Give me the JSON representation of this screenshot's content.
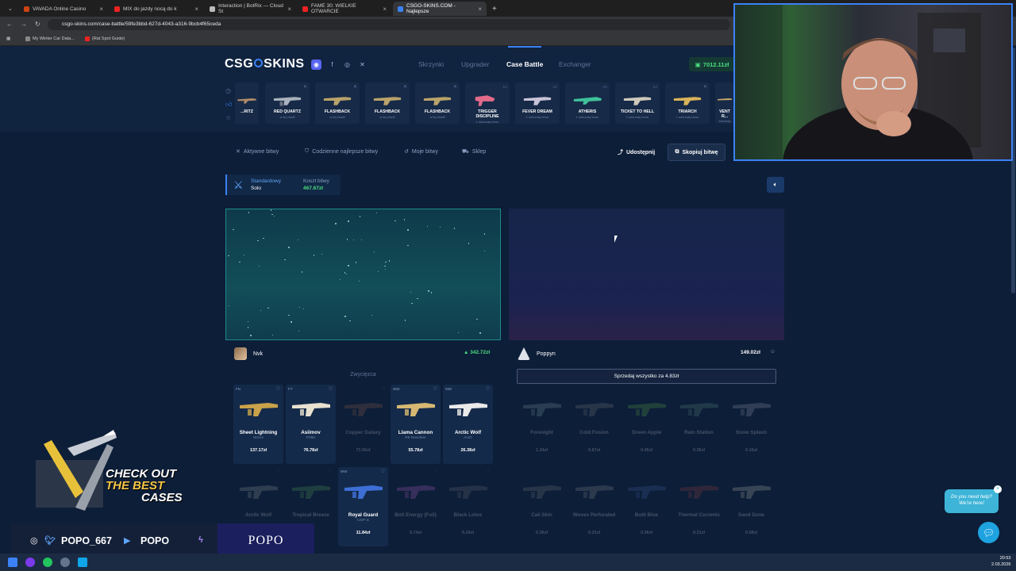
{
  "browser": {
    "tabs": [
      {
        "title": "VAVADA Online Casino"
      },
      {
        "title": "MIX do jazdy nocą do k"
      },
      {
        "title": "Interaction | BotRix — Cloud St"
      },
      {
        "title": "FAME 30: WIELKIE OTWARCIE"
      },
      {
        "title": "CSGO-SKINS.COM - Najlepsze"
      }
    ],
    "new_tab": "+",
    "url": "csgo-skins.com/case-battle/59fe3bbd-627d-4043-a316-9bcb4f65ceda",
    "bookmarks": [
      "My Winter Car Data...",
      "(Rat Spot Guide)"
    ]
  },
  "site": {
    "logo_left": "CSG",
    "logo_right": "SKINS",
    "nav": [
      "Skrzynki",
      "Upgrader",
      "Case Battle",
      "Exchanger"
    ],
    "balance": "7012.11zł",
    "drops": [
      {
        "name": "...RITZ",
        "sub": ""
      },
      {
        "name": "RED QUARTZ",
        "sub": "w tej chwili"
      },
      {
        "name": "FLASHBACK",
        "sub": "w tej chwili"
      },
      {
        "name": "FLASHBACK",
        "sub": "w tej chwili"
      },
      {
        "name": "FLASHBACK",
        "sub": "w tej chwili"
      },
      {
        "name": "TRIGGER DISCIPLINE",
        "sub": "1 sekundę temu"
      },
      {
        "name": "FEVER DREAM",
        "sub": "1 sekundę temu"
      },
      {
        "name": "ATHERIS",
        "sub": "1 sekundę temu"
      },
      {
        "name": "TICKET TO HELL",
        "sub": "1 sekundę temu"
      },
      {
        "name": "TRIARCH",
        "sub": "1 sekundę temu"
      },
      {
        "name": "VENT R...",
        "sub": "1 sekundę"
      }
    ],
    "subnav": [
      "Aktywne bitwy",
      "Codzienne najlepsze bitwy",
      "Moje bitwy",
      "Sklep"
    ],
    "share_label": "Udostępnij",
    "copy_label": "Skopiuj bitwę",
    "mode": {
      "label": "Standardowy",
      "value": "Solo",
      "cost_label": "Koszt bitwy",
      "cost": "467.67zł"
    },
    "players": [
      {
        "name": "Nvk",
        "value": "342.72zł"
      },
      {
        "name": "Poppyn",
        "value": "149.02zł"
      }
    ],
    "winner_label": "Zwycięzca",
    "sell_all": "Sprzedaj wszystko za 4.83zł",
    "left_items": [
      {
        "quality": "FN",
        "name": "Sheet Lightning",
        "skin": "M4A4",
        "price": "137.17zł",
        "state": "won",
        "color": "#c9a24a"
      },
      {
        "quality": "FT",
        "name": "Asiimov",
        "skin": "P250",
        "price": "76.78zł",
        "state": "won",
        "color": "#e9e1d0"
      },
      {
        "quality": "",
        "name": "Copper Galaxy",
        "skin": "",
        "price": "71.56zł",
        "state": "faded",
        "color": "#a56a4a"
      },
      {
        "quality": "WW",
        "name": "Llama Cannon",
        "skin": "R8 Revolver",
        "price": "55.78zł",
        "state": "won",
        "color": "#d6b872"
      },
      {
        "quality": "MW",
        "name": "Arctic Wolf",
        "skin": "AUG",
        "price": "26.38zł",
        "state": "won",
        "color": "#eaeaea"
      },
      {
        "quality": "",
        "name": "Arctic Wolf",
        "skin": "",
        "price": "",
        "state": "faded",
        "color": "#aaa"
      },
      {
        "quality": "",
        "name": "Tropical Breeze",
        "skin": "",
        "price": "",
        "state": "faded",
        "color": "#5cae5c"
      },
      {
        "quality": "WW",
        "name": "Royal Guard",
        "skin": "USP-S",
        "price": "11.84zł",
        "state": "won",
        "color": "#3d6fd6"
      },
      {
        "quality": "",
        "name": "Bolt Energy (Foil)",
        "skin": "",
        "price": "9.74zł",
        "state": "faded",
        "color": "#c86ad6"
      },
      {
        "quality": "",
        "name": "Black Lotus",
        "skin": "",
        "price": "5.24zł",
        "state": "faded",
        "color": "#777"
      }
    ],
    "right_items": [
      {
        "name": "Foresight",
        "price": "1.34zł",
        "color": "#8aa"
      },
      {
        "name": "Cold Fusion",
        "price": "0.67zł",
        "color": "#888"
      },
      {
        "name": "Green Apple",
        "price": "0.45zł",
        "color": "#6b4"
      },
      {
        "name": "Rain Station",
        "price": "0.36zł",
        "color": "#698"
      },
      {
        "name": "Snow Splash",
        "price": "0.16zł",
        "color": "#aab"
      },
      {
        "name": "Cali Skin",
        "price": "0.36zł",
        "color": "#888"
      },
      {
        "name": "Woves Perforated",
        "price": "0.21zł",
        "color": "#999"
      },
      {
        "name": "Bulit Blue",
        "price": "0.36zł",
        "color": "#46a"
      },
      {
        "name": "Thermal Currents",
        "price": "0.21zł",
        "color": "#a44"
      },
      {
        "name": "Sand Dune",
        "price": "0.08zł",
        "color": "#ccb"
      }
    ]
  },
  "overlay": {
    "promo_line1": "CHECK OUT",
    "promo_line2": "THE BEST",
    "promo_line3": "CASES",
    "twitter_handle": "POPO_667",
    "youtube_handle": "POPO",
    "brand": "POPO",
    "help_text": "Do you need help? We're here!"
  },
  "taskbar": {
    "time": "20:53",
    "date": "2.03.2026"
  }
}
